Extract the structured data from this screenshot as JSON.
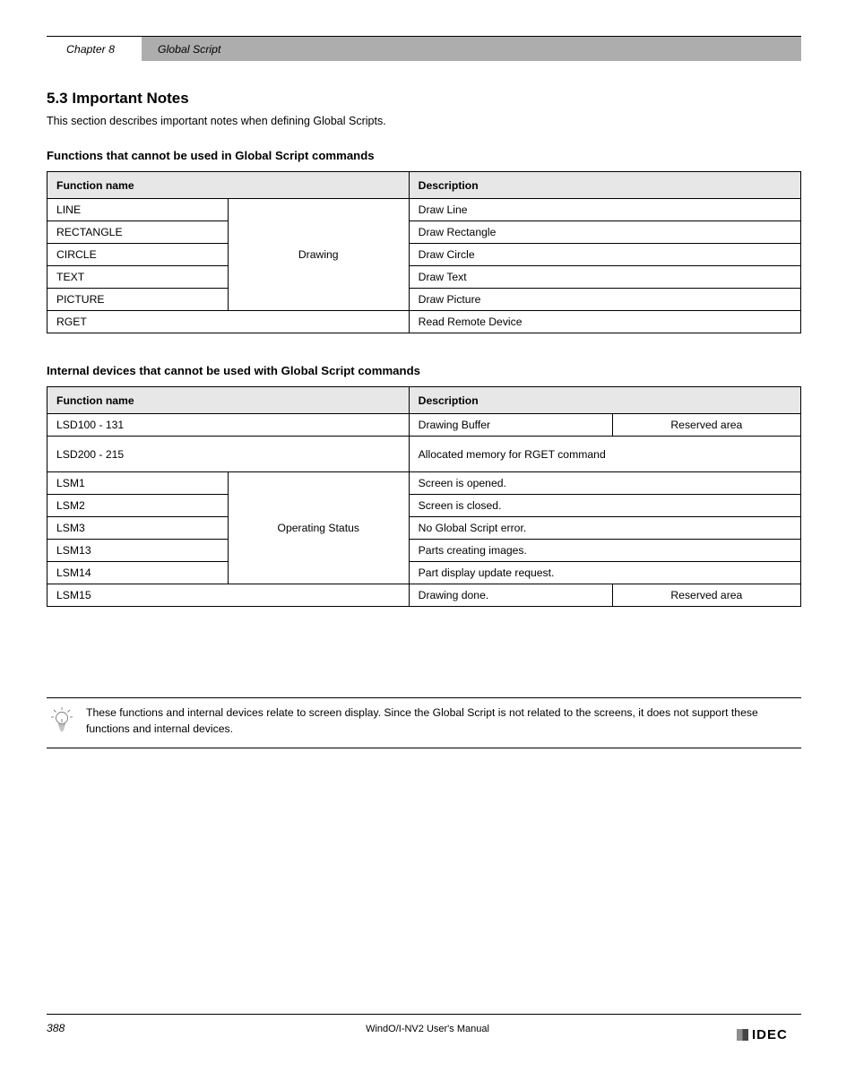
{
  "header": {
    "chapter_label": "Chapter 8",
    "chapter_title": "Global Script"
  },
  "section": {
    "title": "5.3  Important Notes",
    "lead_para": "This section describes important notes when defining Global Scripts."
  },
  "sub1": {
    "heading": "Functions that cannot be used in Global Script commands",
    "table": {
      "h1": "Function name",
      "h2": "Description",
      "rows": [
        {
          "c1": "LINE",
          "c2": "",
          "c3": "Draw Line"
        },
        {
          "c1": "RECTANGLE",
          "c2": "Drawing",
          "c3": "Draw Rectangle",
          "rowspan": 5
        },
        {
          "c1": "CIRCLE",
          "c3": "Draw Circle"
        },
        {
          "c1": "TEXT",
          "c3": "Draw Text"
        },
        {
          "c1": "PICTURE",
          "c3": "Draw Picture"
        },
        {
          "c1": "RGET",
          "c3": "Read Remote Device"
        }
      ]
    }
  },
  "sub2": {
    "heading": "Internal devices that cannot be used with Global Script commands",
    "table": {
      "h1": "Function name",
      "h2": "Description",
      "rows_a": [
        {
          "c1": "LSD100 - 131",
          "c2": "Drawing Buffer",
          "c3": "Reserved area"
        },
        {
          "c1": "LSD200 - 215",
          "c2": "Allocated memory for RGET command"
        }
      ],
      "rows_b": [
        {
          "c1": "LSM1",
          "c2": "Operating Status",
          "c3": "Screen is opened.",
          "rowspan": 5
        },
        {
          "c1": "LSM2",
          "c3": "Screen is closed."
        },
        {
          "c1": "LSM3",
          "c3": "No Global Script error."
        },
        {
          "c1": "LSM13",
          "c3": "Parts creating images."
        },
        {
          "c1": "LSM14",
          "c3": "Part display update request."
        }
      ],
      "rows_c": [
        {
          "c1": "LSM15",
          "c2": "Drawing done.",
          "c3": "Reserved area"
        }
      ]
    }
  },
  "note": {
    "text": "These functions and internal devices relate to screen display. Since the Global Script is not related to the screens, it does not support these functions and internal devices."
  },
  "footer": {
    "page": "388",
    "doc": "WindO/I-NV2 User's Manual"
  },
  "logo": {
    "text": "IDEC"
  }
}
